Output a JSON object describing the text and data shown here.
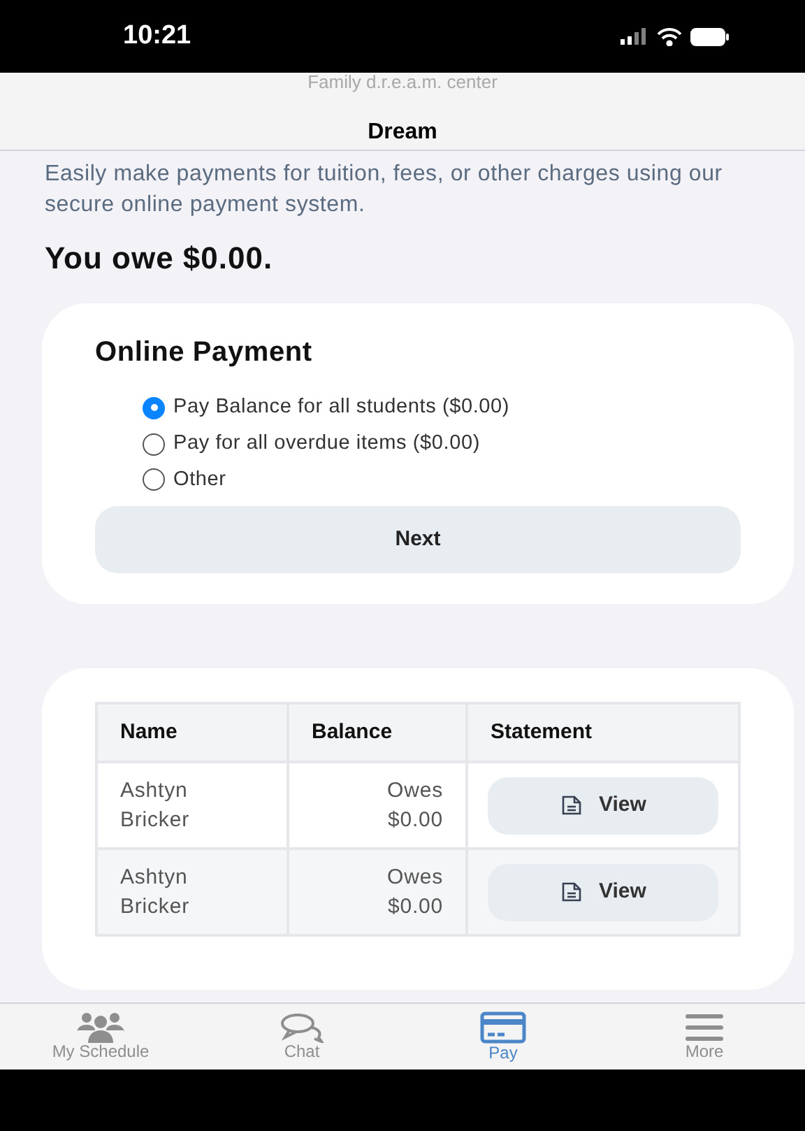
{
  "status_bar": {
    "time": "10:21"
  },
  "header": {
    "subtitle": "Family d.r.e.a.m. center",
    "title": "Dream"
  },
  "intro": "Easily make payments for tuition, fees, or other charges using our secure online payment system.",
  "owed": "You owe $0.00.",
  "payment": {
    "title": "Online Payment",
    "options": [
      {
        "label": "Pay Balance for all students ($0.00)",
        "selected": true
      },
      {
        "label": "Pay for all overdue items ($0.00)",
        "selected": false
      },
      {
        "label": "Other",
        "selected": false
      }
    ],
    "button": "Next"
  },
  "table": {
    "columns": [
      "Name",
      "Balance",
      "Statement"
    ],
    "rows": [
      {
        "name": "Ashtyn Bricker",
        "balance": "Owes $0.00",
        "action": "View"
      },
      {
        "name": "Ashtyn Bricker",
        "balance": "Owes $0.00",
        "action": "View"
      }
    ]
  },
  "tab_bar": [
    {
      "label": "My Schedule",
      "kind": "people",
      "selected": false
    },
    {
      "label": "Chat",
      "kind": "chat",
      "selected": false
    },
    {
      "label": "Pay",
      "kind": "card",
      "selected": true
    },
    {
      "label": "More",
      "kind": "menu",
      "selected": false
    }
  ]
}
